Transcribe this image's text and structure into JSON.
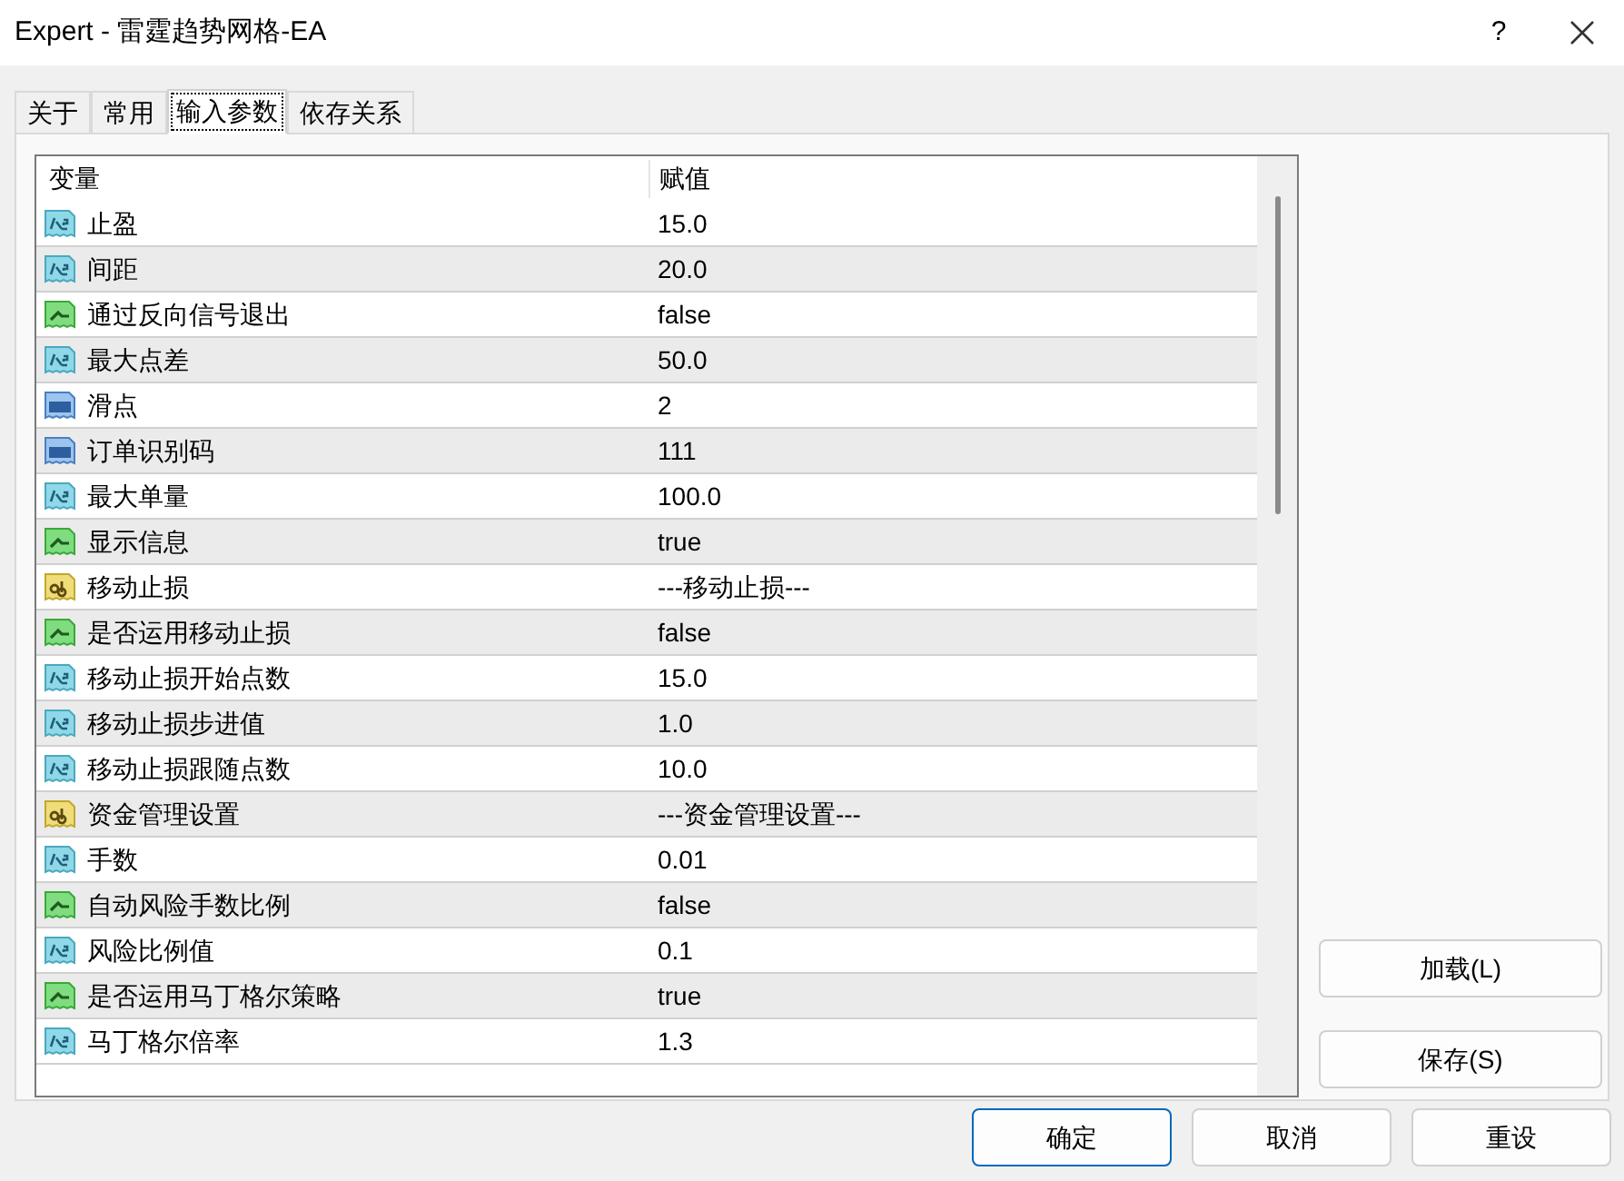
{
  "window": {
    "title": "Expert - 雷霆趋势网格-EA",
    "help": "?"
  },
  "tabs": [
    {
      "label": "关于",
      "selected": false
    },
    {
      "label": "常用",
      "selected": false
    },
    {
      "label": "输入参数",
      "selected": true
    },
    {
      "label": "依存关系",
      "selected": false
    }
  ],
  "table": {
    "columns": [
      "变量",
      "赋值"
    ],
    "rows": [
      {
        "kind": "double",
        "name": "止盈",
        "value": "15.0"
      },
      {
        "kind": "double",
        "name": "间距",
        "value": "20.0"
      },
      {
        "kind": "bool",
        "name": "通过反向信号退出",
        "value": "false"
      },
      {
        "kind": "double",
        "name": "最大点差",
        "value": "50.0"
      },
      {
        "kind": "int",
        "name": "滑点",
        "value": "2"
      },
      {
        "kind": "int",
        "name": "订单识别码",
        "value": "111"
      },
      {
        "kind": "double",
        "name": "最大单量",
        "value": "100.0"
      },
      {
        "kind": "bool",
        "name": "显示信息",
        "value": "true"
      },
      {
        "kind": "string",
        "name": "移动止损",
        "value": "---移动止损---"
      },
      {
        "kind": "bool",
        "name": "是否运用移动止损",
        "value": "false"
      },
      {
        "kind": "double",
        "name": "移动止损开始点数",
        "value": "15.0"
      },
      {
        "kind": "double",
        "name": "移动止损步进值",
        "value": "1.0"
      },
      {
        "kind": "double",
        "name": "移动止损跟随点数",
        "value": "10.0"
      },
      {
        "kind": "string",
        "name": "资金管理设置",
        "value": "---资金管理设置---"
      },
      {
        "kind": "double",
        "name": "手数",
        "value": "0.01"
      },
      {
        "kind": "bool",
        "name": "自动风险手数比例",
        "value": "false"
      },
      {
        "kind": "double",
        "name": "风险比例值",
        "value": "0.1"
      },
      {
        "kind": "bool",
        "name": "是否运用马丁格尔策略",
        "value": "true"
      },
      {
        "kind": "double",
        "name": "马丁格尔倍率",
        "value": "1.3"
      }
    ]
  },
  "side_buttons": [
    "加载(L)",
    "保存(S)"
  ],
  "buttons": [
    {
      "label": "确定",
      "default": true
    },
    {
      "label": "取消",
      "default": false
    },
    {
      "label": "重设",
      "default": false
    }
  ]
}
